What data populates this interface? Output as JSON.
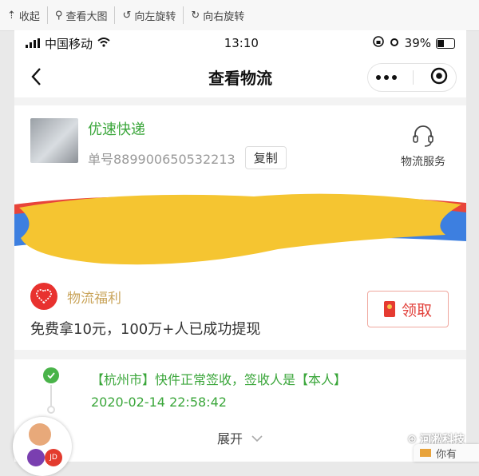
{
  "viewer": {
    "collapse": "收起",
    "view_large": "查看大图",
    "rotate_left": "向左旋转",
    "rotate_right": "向右旋转"
  },
  "status_bar": {
    "carrier": "中国移动",
    "time": "13:10",
    "battery": "39%"
  },
  "nav": {
    "title": "查看物流"
  },
  "shipment": {
    "courier": "优速快递",
    "tracking_label": "单号889900650532213",
    "copy_label": "复制",
    "service_label": "物流服务"
  },
  "welfare": {
    "title": "物流福利",
    "benefit_text": "免费拿10元，100万+人已成功提现",
    "receive_label": "领取"
  },
  "timeline": {
    "event": "【杭州市】快件正常签收，签收人是【本人】",
    "time": "2020-02-14 22:58:42",
    "expand_label": "展开"
  },
  "watermark": "河淞科技",
  "notification": "你有",
  "colors": {
    "green": "#3aa63a",
    "red": "#e2413b",
    "gold": "#c9a45a"
  }
}
